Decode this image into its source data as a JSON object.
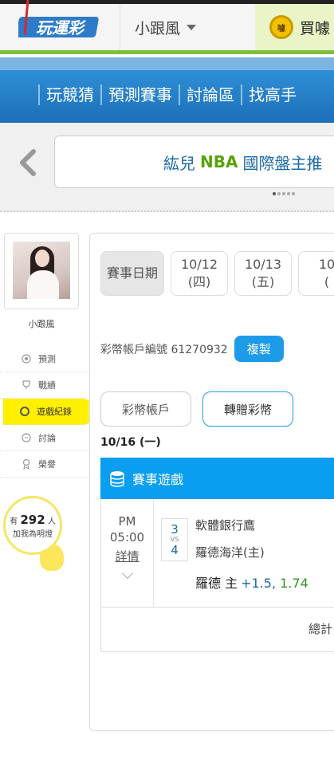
{
  "header": {
    "logo_text": "玩運彩",
    "user_menu_label": "小跟風",
    "buy_label": "買噱",
    "coin_label": "噱"
  },
  "nav": {
    "items": [
      "玩競猜",
      "預測賽事",
      "討論區",
      "找高手"
    ]
  },
  "marquee": {
    "name": "紘兒",
    "highlight": "NBA",
    "rest": "國際盤主推"
  },
  "sidebar": {
    "user_name": "小跟風",
    "items": [
      {
        "label": "預測",
        "icon": "target-icon"
      },
      {
        "label": "戰績",
        "icon": "trophy-icon"
      },
      {
        "label": "遊戲紀錄",
        "icon": "ring-icon",
        "active": true
      },
      {
        "label": "討論",
        "icon": "chat-icon"
      },
      {
        "label": "榮譽",
        "icon": "medal-icon"
      }
    ],
    "fans": {
      "prefix": "有",
      "count": "292",
      "suffix": "人",
      "caption": "加我為明燈"
    }
  },
  "main": {
    "date_tabs": [
      {
        "line1": "賽事日期",
        "line2": ""
      },
      {
        "line1": "10/12",
        "line2": "(四)"
      },
      {
        "line1": "10/13",
        "line2": "(五)"
      },
      {
        "line1": "10",
        "line2": "("
      }
    ],
    "account_label": "彩幣帳戶編號 61270932",
    "copy_label": "複製",
    "account_btn": "彩幣帳戶",
    "transfer_btn": "轉贈彩幣",
    "current_date": "10/16 (一)",
    "section_title": "賽事遊戲",
    "game": {
      "ampm": "PM",
      "time": "05:00",
      "detail": "詳情",
      "score_a": "3",
      "vs": "VS",
      "score_b": "4",
      "team_a": "軟體銀行鷹",
      "team_b": "羅德海洋(主)",
      "pick_team": "羅德 主",
      "pick_line": "+1.5,",
      "pick_odds": "1.74"
    },
    "total_label": "總計"
  },
  "colors": {
    "accent_blue": "#0a9ef0",
    "accent_green": "#7fbf3b",
    "active_yellow": "#fff000"
  }
}
